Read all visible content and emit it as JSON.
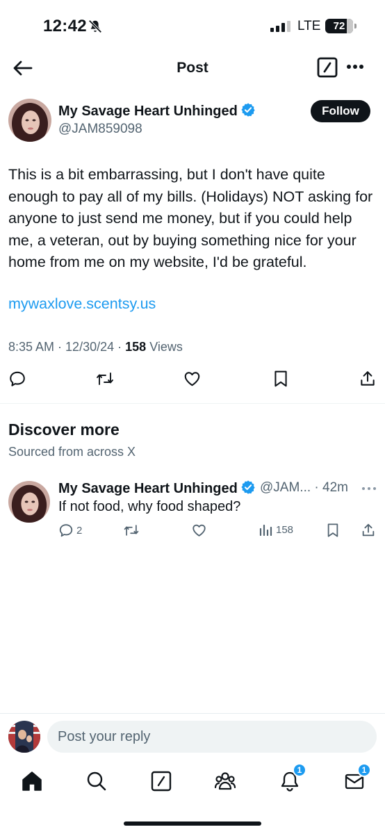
{
  "status_bar": {
    "time": "12:42",
    "network": "LTE",
    "battery": "72"
  },
  "header": {
    "title": "Post"
  },
  "post": {
    "author_name": "My Savage Heart Unhinged",
    "author_handle": "@JAM859098",
    "follow_label": "Follow",
    "text": "This is a bit embarrassing, but I don't have quite enough to pay all of my bills. (Holidays) NOT asking for anyone to just send me money, but if you could help me, a veteran, out by buying something nice for your home from me on my website, I'd be grateful.",
    "link": "mywaxlove.scentsy.us",
    "time": "8:35 AM",
    "date": "12/30/24",
    "views_count": "158",
    "views_label": "Views"
  },
  "discover": {
    "title": "Discover more",
    "subtitle": "Sourced from across X"
  },
  "related_post": {
    "author_name": "My Savage Heart Unhinged",
    "author_handle": "@JAM...",
    "age": "42m",
    "text": "If not food, why food shaped?",
    "reply_count": "2",
    "views_count": "158"
  },
  "reply": {
    "placeholder": "Post your reply"
  },
  "tab_bar": {
    "notifications_badge": "1",
    "messages_badge": "1"
  },
  "colors": {
    "accent": "#1d9bf0",
    "text": "#0f1419",
    "secondary": "#536471"
  }
}
